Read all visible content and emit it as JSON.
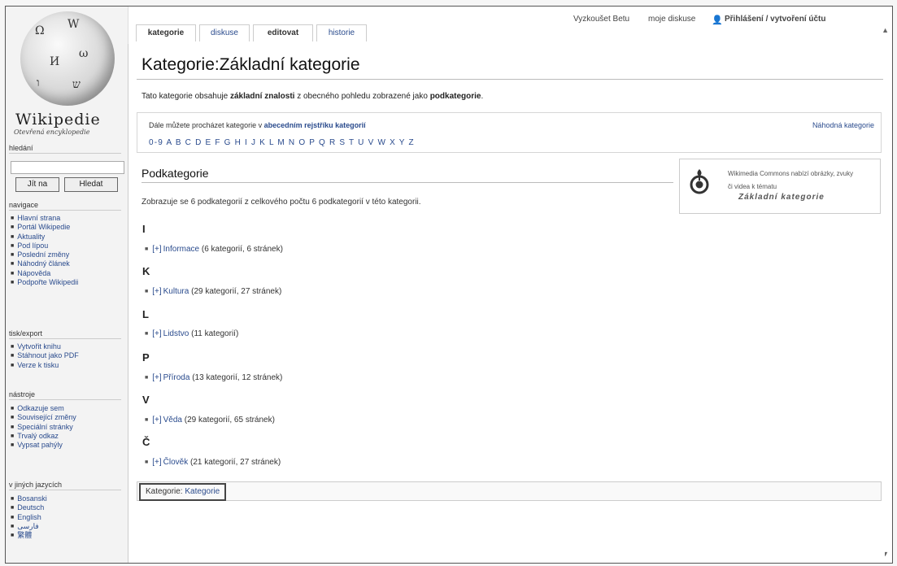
{
  "sidebar": {
    "logo_name": "Wikipedie",
    "logo_tagline": "Otevřená encyklopedie",
    "search_heading": "hledání",
    "search_value": "",
    "go_button": "Jít na",
    "search_button": "Hledat",
    "nav_heading": "navigace",
    "nav_items": [
      "Hlavní strana",
      "Portál Wikipedie",
      "Aktuality",
      "Pod lípou",
      "Poslední změny",
      "Náhodný článek",
      "Nápověda",
      "Podpořte Wikipedii"
    ],
    "print_heading": "tisk/export",
    "print_items": [
      "Vytvořit knihu",
      "Stáhnout jako PDF",
      "Verze k tisku"
    ],
    "tools_heading": "nástroje",
    "tools_items": [
      "Odkazuje sem",
      "Související změny",
      "Speciální stránky",
      "Trvalý odkaz",
      "Vypsat pahýly"
    ],
    "lang_heading": "v jiných jazycích",
    "lang_items": [
      "Bosanski",
      "Deutsch",
      "English",
      "فارسی",
      "繁體"
    ]
  },
  "tabs": [
    "kategorie",
    "diskuse",
    "editovat",
    "historie"
  ],
  "personal": {
    "try_beta": "Vyzkoušet Betu",
    "my_talk": "moje diskuse",
    "login": "Přihlášení / vytvoření účtu"
  },
  "page": {
    "title": "Kategorie:Základní kategorie",
    "intro_a": "Tato kategorie obsahuje ",
    "intro_b": "základní znalosti",
    "intro_c": " z obecného pohledu zobrazené jako ",
    "intro_d": "podkategorie",
    "intro_e": ".",
    "toc_a": "Dále můžete procházet kategorie v ",
    "toc_b": "abecedním rejstříku kategorií",
    "toc_random": "Náhodná kategorie",
    "toc_letters": [
      "0-9",
      "A",
      "B",
      "C",
      "D",
      "E",
      "F",
      "G",
      "H",
      "I",
      "J",
      "K",
      "L",
      "M",
      "N",
      "O",
      "P",
      "Q",
      "R",
      "S",
      "T",
      "U",
      "V",
      "W",
      "X",
      "Y",
      "Z"
    ],
    "commons_line1": "Wikimedia Commons nabízí obrázky, zvuky",
    "commons_line2": "či videa k tématu",
    "commons_link": "Základní kategorie",
    "subcat_heading": "Podkategorie",
    "subcat_count": "Zobrazuje se 6 podkategorií z celkového počtu 6 podkategorií v této kategorii.",
    "groups": [
      {
        "letter": "I",
        "plus": "[+]",
        "name": "Informace",
        "count": "(6 kategorií, 6 stránek)"
      },
      {
        "letter": "K",
        "plus": "[+]",
        "name": "Kultura",
        "count": "(29 kategorií, 27 stránek)"
      },
      {
        "letter": "L",
        "plus": "[+]",
        "name": "Lidstvo",
        "count": "(11 kategorií)"
      },
      {
        "letter": "P",
        "plus": "[+]",
        "name": "Příroda",
        "count": "(13 kategorií, 12 stránek)"
      },
      {
        "letter": "V",
        "plus": "[+]",
        "name": "Věda",
        "count": "(29 kategorií, 65 stránek)"
      },
      {
        "letter": "Č",
        "plus": "[+]",
        "name": "Člověk",
        "count": "(21 kategorií, 27 stránek)"
      }
    ],
    "catlinks_label": "Kategorie:",
    "catlinks_value": "Kategorie"
  }
}
